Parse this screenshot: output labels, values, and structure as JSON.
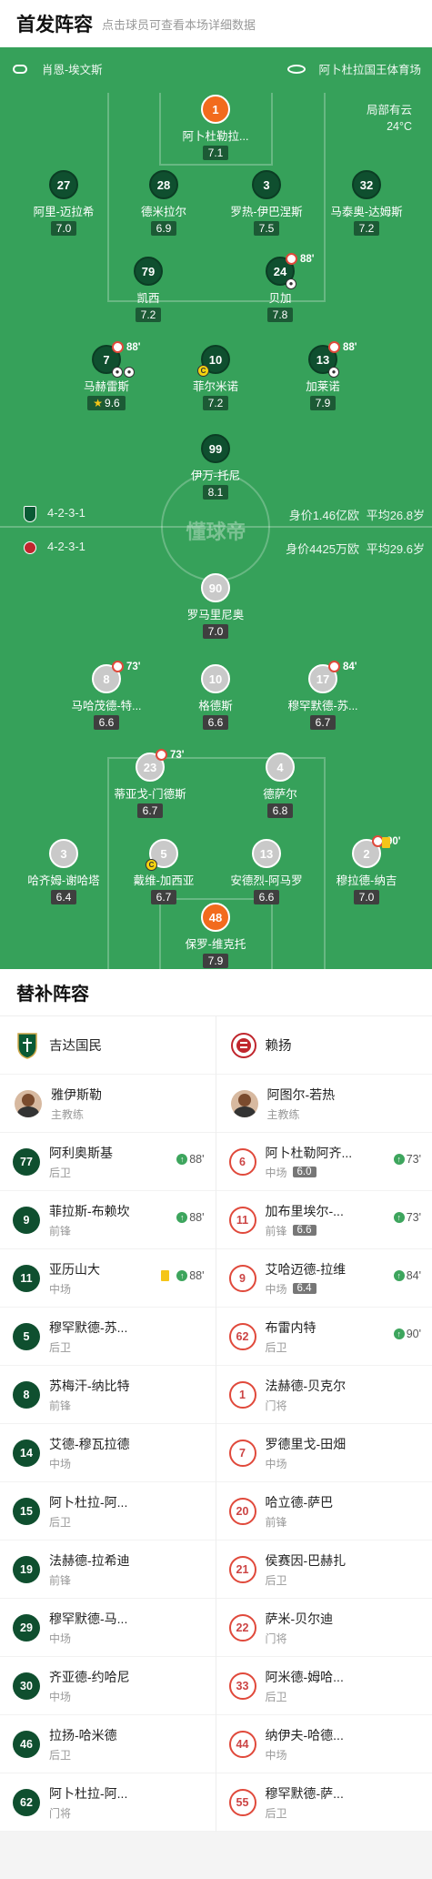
{
  "header": {
    "title": "首发阵容",
    "subtitle": "点击球员可查看本场详细数据"
  },
  "match": {
    "referee": "肖恩-埃文斯",
    "stadium": "阿卜杜拉国王体育场",
    "weather": "局部有云",
    "temperature": "24°C",
    "watermark": "懂球帝"
  },
  "home": {
    "name": "吉达国民",
    "formation": "4-2-3-1",
    "value": "身价1.46亿欧",
    "avg_age": "平均26.8岁",
    "players": [
      {
        "num": "1",
        "name": "阿卜杜勒拉...",
        "rating": "7.1",
        "gk": true
      },
      {
        "num": "27",
        "name": "阿里-迈拉希",
        "rating": "7.0"
      },
      {
        "num": "28",
        "name": "德米拉尔",
        "rating": "6.9"
      },
      {
        "num": "3",
        "name": "罗热-伊巴涅斯",
        "rating": "7.5"
      },
      {
        "num": "32",
        "name": "马泰奥-达姆斯",
        "rating": "7.2"
      },
      {
        "num": "79",
        "name": "凯西",
        "rating": "7.2"
      },
      {
        "num": "24",
        "name": "贝加",
        "rating": "7.8",
        "sub": "88'"
      },
      {
        "num": "7",
        "name": "马赫雷斯",
        "rating": "9.6",
        "sub": "88'",
        "star": true
      },
      {
        "num": "10",
        "name": "菲尔米诺",
        "rating": "7.2",
        "captain": "C"
      },
      {
        "num": "13",
        "name": "加莱诺",
        "rating": "7.9",
        "sub": "88'"
      },
      {
        "num": "99",
        "name": "伊万-托尼",
        "rating": "8.1"
      }
    ]
  },
  "away": {
    "name": "赖扬",
    "formation": "4-2-3-1",
    "value": "身价4425万欧",
    "avg_age": "平均29.6岁",
    "players": [
      {
        "num": "90",
        "name": "罗马里尼奥",
        "rating": "7.0"
      },
      {
        "num": "8",
        "name": "马哈茂德-特...",
        "rating": "6.6",
        "sub": "73'"
      },
      {
        "num": "10",
        "name": "格德斯",
        "rating": "6.6"
      },
      {
        "num": "17",
        "name": "穆罕默德-苏...",
        "rating": "6.7",
        "sub": "84'"
      },
      {
        "num": "23",
        "name": "蒂亚戈-门德斯",
        "rating": "6.7",
        "sub": "73'"
      },
      {
        "num": "4",
        "name": "德萨尔",
        "rating": "6.8"
      },
      {
        "num": "3",
        "name": "哈齐姆-谢哈塔",
        "rating": "6.4"
      },
      {
        "num": "5",
        "name": "戴维-加西亚",
        "rating": "6.7",
        "captain": "C"
      },
      {
        "num": "13",
        "name": "安德烈-阿马罗",
        "rating": "6.6"
      },
      {
        "num": "2",
        "name": "穆拉德-纳吉",
        "rating": "7.0",
        "sub": "90'",
        "yellow": true
      },
      {
        "num": "48",
        "name": "保罗-维克托",
        "rating": "7.9",
        "gk": true
      }
    ]
  },
  "subs_section": {
    "title": "替补阵容",
    "home_coach": {
      "name": "雅伊斯勒",
      "role": "主教练"
    },
    "away_coach": {
      "name": "阿图尔-若热",
      "role": "主教练"
    },
    "home_subs": [
      {
        "num": "77",
        "name": "阿利奥斯基",
        "pos": "后卫",
        "in": "88'"
      },
      {
        "num": "9",
        "name": "菲拉斯-布赖坎",
        "pos": "前锋",
        "in": "88'"
      },
      {
        "num": "11",
        "name": "亚历山大",
        "pos": "中场",
        "in": "88'",
        "yellow": true
      },
      {
        "num": "5",
        "name": "穆罕默德-苏...",
        "pos": "后卫"
      },
      {
        "num": "8",
        "name": "苏梅汗-纳比特",
        "pos": "前锋"
      },
      {
        "num": "14",
        "name": "艾德-穆瓦拉德",
        "pos": "中场"
      },
      {
        "num": "15",
        "name": "阿卜杜拉-阿...",
        "pos": "后卫"
      },
      {
        "num": "19",
        "name": "法赫德-拉希迪",
        "pos": "前锋"
      },
      {
        "num": "29",
        "name": "穆罕默德-马...",
        "pos": "中场"
      },
      {
        "num": "30",
        "name": "齐亚德-约哈尼",
        "pos": "中场"
      },
      {
        "num": "46",
        "name": "拉扬-哈米德",
        "pos": "后卫"
      },
      {
        "num": "62",
        "name": "阿卜杜拉-阿...",
        "pos": "门将"
      }
    ],
    "away_subs": [
      {
        "num": "6",
        "name": "阿卜杜勒阿齐...",
        "pos": "中场",
        "rating": "6.0",
        "in": "73'"
      },
      {
        "num": "11",
        "name": "加布里埃尔-...",
        "pos": "前锋",
        "rating": "6.6",
        "in": "73'"
      },
      {
        "num": "9",
        "name": "艾哈迈德-拉维",
        "pos": "中场",
        "rating": "6.4",
        "in": "84'"
      },
      {
        "num": "62",
        "name": "布雷内特",
        "pos": "后卫",
        "in": "90'"
      },
      {
        "num": "1",
        "name": "法赫德-贝克尔",
        "pos": "门将"
      },
      {
        "num": "7",
        "name": "罗德里戈-田畑",
        "pos": "中场"
      },
      {
        "num": "20",
        "name": "哈立德-萨巴",
        "pos": "前锋"
      },
      {
        "num": "21",
        "name": "侯赛因-巴赫扎",
        "pos": "后卫"
      },
      {
        "num": "22",
        "name": "萨米-贝尔迪",
        "pos": "门将"
      },
      {
        "num": "33",
        "name": "阿米德-姆哈...",
        "pos": "后卫"
      },
      {
        "num": "44",
        "name": "纳伊夫-哈德...",
        "pos": "中场"
      },
      {
        "num": "55",
        "name": "穆罕默德-萨...",
        "pos": "后卫"
      }
    ]
  }
}
